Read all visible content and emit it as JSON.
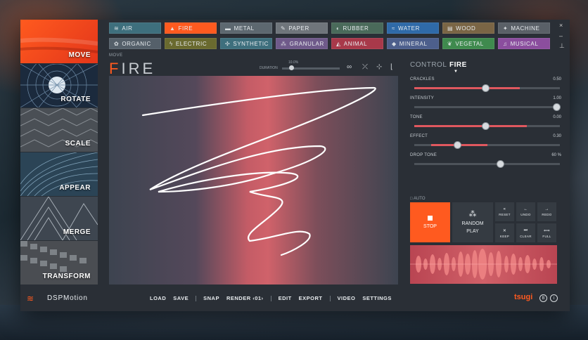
{
  "sidebar": {
    "items": [
      {
        "label": "MOVE",
        "active": true
      },
      {
        "label": "ROTATE",
        "active": false
      },
      {
        "label": "SCALE",
        "active": false
      },
      {
        "label": "APPEAR",
        "active": false
      },
      {
        "label": "MERGE",
        "active": false
      },
      {
        "label": "TRANSFORM",
        "active": false
      }
    ]
  },
  "categories": [
    {
      "label": "AIR",
      "icon": "wind-icon",
      "color": "#3e6f7d"
    },
    {
      "label": "FIRE",
      "icon": "flame-icon",
      "color": "#ff5a1f",
      "active": true
    },
    {
      "label": "METAL",
      "icon": "bar-icon",
      "color": "#5d6870"
    },
    {
      "label": "PAPER",
      "icon": "paper-icon",
      "color": "#6f757b"
    },
    {
      "label": "RUBBER",
      "icon": "ball-icon",
      "color": "#4a6a5a"
    },
    {
      "label": "WATER",
      "icon": "wave-icon",
      "color": "#2f6aa8"
    },
    {
      "label": "WOOD",
      "icon": "wood-icon",
      "color": "#7a6545"
    },
    {
      "label": "MACHINE",
      "icon": "wrench-icon",
      "color": "#5a6067"
    },
    {
      "label": "ORGANIC",
      "icon": "organic-icon",
      "color": "#55606a"
    },
    {
      "label": "ELECTRIC",
      "icon": "bolt-icon",
      "color": "#6a6a2f"
    },
    {
      "label": "SYNTHETIC",
      "icon": "synth-icon",
      "color": "#3e6f7d"
    },
    {
      "label": "GRANULAR",
      "icon": "granular-icon",
      "color": "#6f5a8a"
    },
    {
      "label": "ANIMAL",
      "icon": "animal-icon",
      "color": "#a8394a"
    },
    {
      "label": "MINERAL",
      "icon": "mineral-icon",
      "color": "#4d5f8c"
    },
    {
      "label": "VEGETAL",
      "icon": "leaf-icon",
      "color": "#3f8a4e"
    },
    {
      "label": "MUSICAL",
      "icon": "note-icon",
      "color": "#8b4e9e"
    }
  ],
  "window_controls": {
    "close": "×",
    "minimize": "–",
    "pin": "⊥"
  },
  "main": {
    "move_label": "MOVE",
    "title_first": "F",
    "title_rest": "IRE",
    "duration_label": "DURATION",
    "duration_value": "10.0%",
    "duration_level": 0.12
  },
  "control": {
    "label": "CONTROL",
    "value": "FIRE",
    "params": [
      {
        "name": "CRACKLES",
        "value": "0.50",
        "level": 0.5
      },
      {
        "name": "INTENSITY",
        "value": "1.00",
        "level": 1.0
      },
      {
        "name": "TONE",
        "value": "0.00",
        "level": 0.5
      },
      {
        "name": "EFFECT",
        "value": "0.30",
        "level": 0.3
      },
      {
        "name": "DROP TONE",
        "value": "60 %",
        "level": 0.6
      }
    ],
    "auto_label": "AUTO",
    "stop_label": "STOP",
    "random_label_1": "RANDOM",
    "random_label_2": "PLAY",
    "reset_label": "RESET",
    "undo_label": "UNDO",
    "redo_label": "REDO",
    "keep_label": "KEEP",
    "clear_label": "CLEAR",
    "full_label": "FULL"
  },
  "footer": {
    "logo_text": "DSPMotion",
    "menu": [
      "LOAD",
      "SAVE",
      "SNAP",
      "RENDER ‹01›",
      "EDIT",
      "EXPORT",
      "VIDEO",
      "SETTINGS"
    ],
    "brand": "tsugi",
    "icon_b": "B",
    "icon_i": "i"
  },
  "colors": {
    "accent": "#ff5a1f",
    "slider_fill": "#e0585f"
  }
}
